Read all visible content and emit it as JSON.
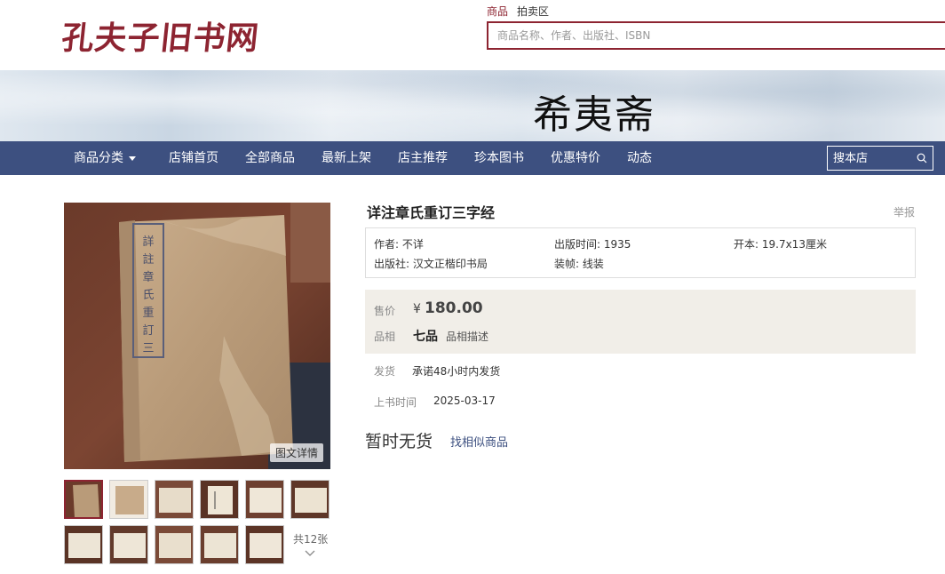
{
  "header": {
    "logo_text": "孔夫子旧书网",
    "search_tabs": [
      "商品",
      "拍卖区"
    ],
    "search_placeholder": "商品名称、作者、出版社、ISBN"
  },
  "banner": {
    "shop_name": "希夷斋"
  },
  "nav": {
    "items": [
      "商品分类",
      "店铺首页",
      "全部商品",
      "最新上架",
      "店主推荐",
      "珍本图书",
      "优惠特价",
      "动态"
    ],
    "shop_search_placeholder": "搜本店"
  },
  "gallery": {
    "detail_button": "图文详情",
    "thumb_count_text": "共12张"
  },
  "product": {
    "title": "详注章氏重订三字经",
    "report": "举报",
    "author": "作者: 不详",
    "publish_time": "出版时间: 1935",
    "format": "开本: 19.7x13厘米",
    "publisher": "出版社: 汉文正楷印书局",
    "binding": "装帧: 线装",
    "price_label": "售价",
    "currency": "¥",
    "price": "180.00",
    "condition_label": "品相",
    "condition": "七品",
    "condition_desc": "品相描述",
    "shipping_label": "发货",
    "shipping": "承诺48小时内发货",
    "listed_label": "上书时间",
    "listed_date": "2025-03-17",
    "stock_status": "暂时无货",
    "similar_link": "找相似商品"
  },
  "colors": {
    "brand": "#8d2431",
    "nav_bg": "#3d5080",
    "price_bg": "#f1eee8"
  }
}
